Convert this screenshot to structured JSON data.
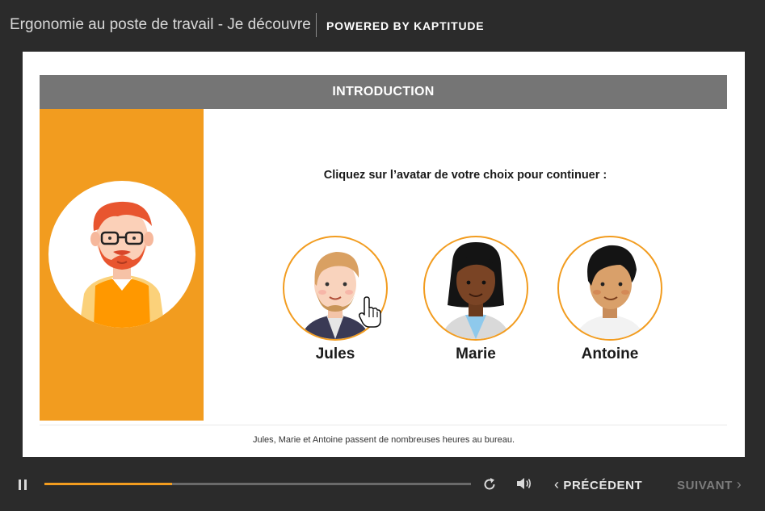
{
  "header": {
    "course_title": "Ergonomie au poste de travail - Je découvre",
    "powered_by": "POWERED BY KAPTITUDE"
  },
  "slide": {
    "section_title": "INTRODUCTION",
    "instruction": "Cliquez sur l’avatar de votre choix pour continuer :",
    "avatars": [
      {
        "name": "Jules"
      },
      {
        "name": "Marie"
      },
      {
        "name": "Antoine"
      }
    ],
    "caption": "Jules, Marie et Antoine passent de nombreuses heures au bureau."
  },
  "controls": {
    "progress": 0.3,
    "prev_label": "PRÉCÉDENT",
    "next_label": "SUIVANT",
    "icons": [
      "pause-icon",
      "replay-icon",
      "volume-icon",
      "chevron-left-icon",
      "chevron-right-icon"
    ]
  },
  "colors": {
    "accent": "#f29c1f",
    "header_band": "#757575",
    "background": "#2b2b2b"
  }
}
